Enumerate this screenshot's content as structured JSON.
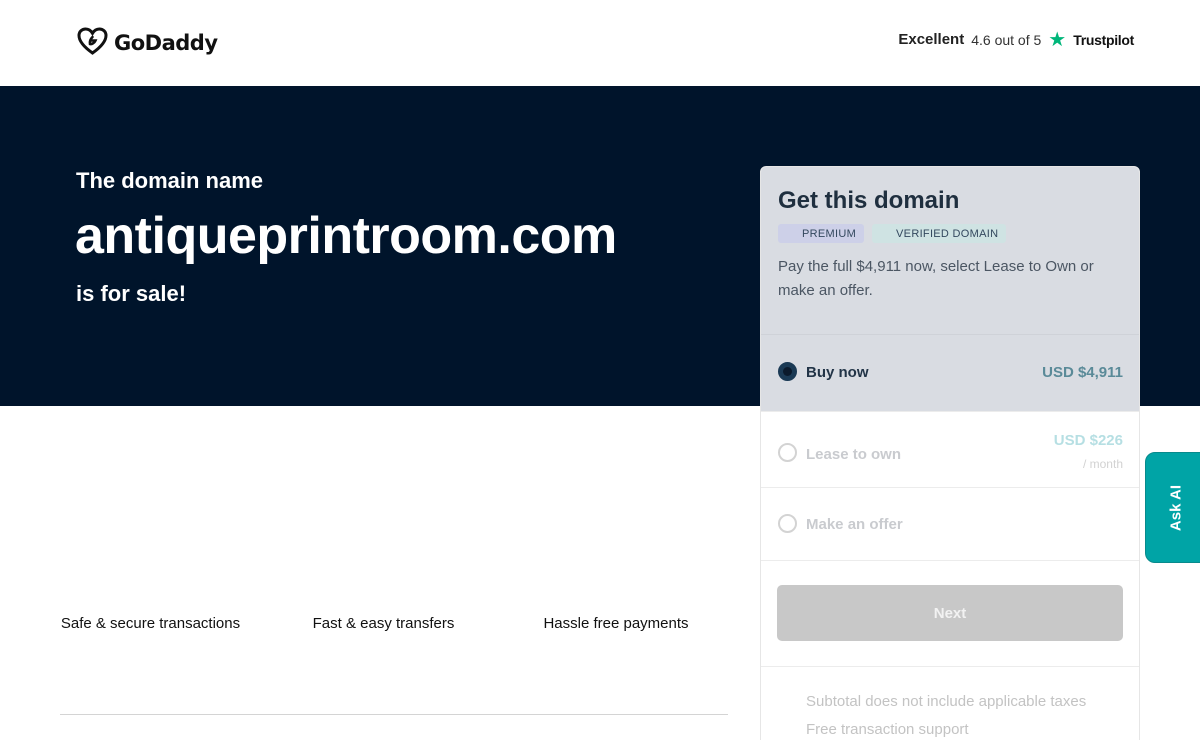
{
  "header": {
    "logo_text": "GoDaddy",
    "trust_rating_word": "Excellent",
    "trust_score": "4.6 out of 5",
    "trust_brand": "Trustpilot"
  },
  "hero": {
    "intro": "The domain name",
    "domain": "antiqueprintroom.com",
    "for_sale": "is for sale!"
  },
  "features": [
    {
      "label": "Safe & secure transactions"
    },
    {
      "label": "Fast & easy transfers"
    },
    {
      "label": "Hassle free payments"
    }
  ],
  "card": {
    "title": "Get this domain",
    "badges": {
      "premium": "PREMIUM",
      "verified": "VERIFIED DOMAIN"
    },
    "description": "Pay the full $4,911 now, select Lease to Own or make an offer.",
    "options": {
      "buy": {
        "label": "Buy now",
        "price": "USD $4,911",
        "selected": true
      },
      "lease": {
        "label": "Lease to own",
        "price": "USD $226",
        "sub": "/ month",
        "selected": false
      },
      "offer": {
        "label": "Make an offer",
        "selected": false
      }
    },
    "next_label": "Next",
    "footnotes": [
      "Subtotal does not include applicable taxes",
      "Free transaction support"
    ]
  },
  "ask_ai": {
    "label": "Ask AI"
  },
  "colors": {
    "hero_bg": "#00142b",
    "accent": "#00a4a6",
    "trustpilot_green": "#00b67a"
  },
  "icons": {
    "logo": "godaddy-heart-logo-icon",
    "star": "trustpilot-star-icon"
  }
}
